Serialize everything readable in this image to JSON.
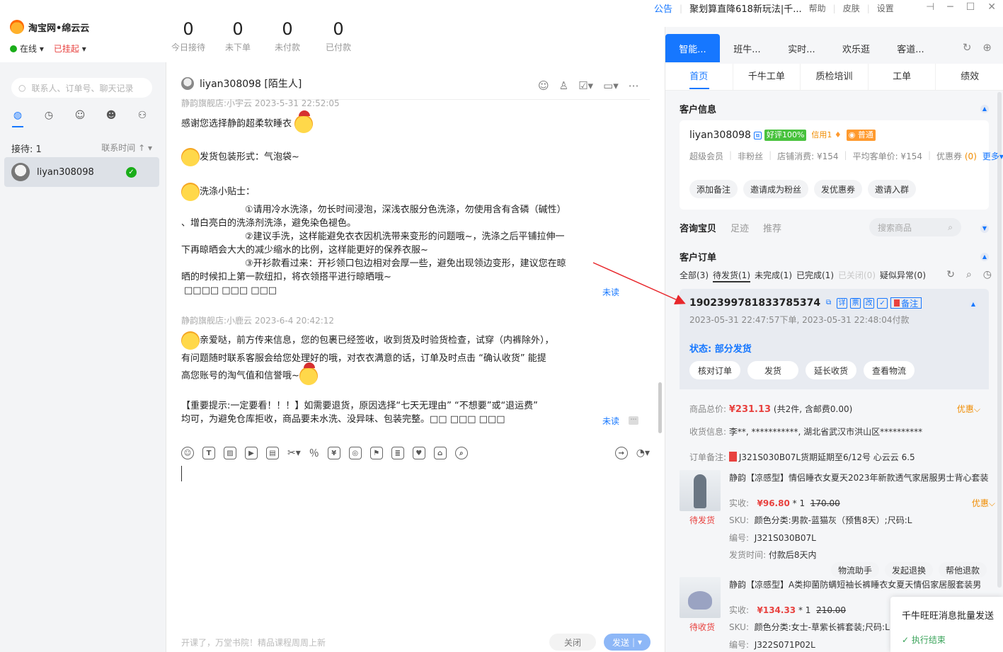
{
  "app": {
    "brand": "淘宝网•绵云云",
    "status_online": "在线",
    "status_hang": "已挂起",
    "stats": [
      {
        "value": "0",
        "label": "今日接待"
      },
      {
        "value": "0",
        "label": "未下单"
      },
      {
        "value": "0",
        "label": "未付款"
      },
      {
        "value": "0",
        "label": "已付款"
      }
    ],
    "notice_label": "公告",
    "notice_text": "聚划算直降618新玩法|千...",
    "menu": [
      "帮助",
      "皮肤",
      "设置"
    ]
  },
  "left": {
    "search_placeholder": "联系人、订单号、聊天记录",
    "recv_label": "接待: 1",
    "sort_label": "联系时间 ↑ ▾",
    "contact_name": "liyan308098"
  },
  "chat": {
    "header_name": "liyan308098 [陌生人]",
    "msg1_meta": "静韵旗舰店:小宇云   2023-5-31 22:52:05",
    "msg1_line1": "感谢您选择静韵超柔软睡衣",
    "msg1_line2": "发货包装形式：气泡袋~",
    "msg1_line3": "洗涤小贴士：",
    "msg1_tip1a": "①请用冷水洗涤，勿长时间浸泡，深浅衣服分色洗涤，勿使用含有含磷（碱性）",
    "msg1_tip1b": "、增白亮白的洗涤剂洗涤，避免染色褪色。",
    "msg1_tip2a": "②建议手洗，这样能避免衣衣因机洗带来变形的问题哦~，洗涤之后平铺拉伸一",
    "msg1_tip2b": "下再晾晒会大大的减少缩水的比例，这样能更好的保养衣服~",
    "msg1_tip3a": "③开衫款看过来：开衫领口包边相对会厚一些，避免出现领边变形，建议您在晾",
    "msg1_tip3b": "晒的时候扣上第一款纽扣，将衣领搭平进行晾晒哦~",
    "msg1_tail": "□□□□ □□□ □□□",
    "msg2_meta": "静韵旗舰店:小鹿云   2023-6-4 20:42:12",
    "msg2_line1": "亲爱哒，前方传来信息，您的包裹已经签收，收到货及时验货检查，试穿（内裤除外），",
    "msg2_line2": "有问题随时联系客服会给您处理好的哦，对衣衣满意的话，订单及时点击  “确认收货”   能提",
    "msg2_line3": "高您账号的淘气值和信誉哦~",
    "msg2_line4": "【重要提示:一定要看！！！】如需要退货，原因选择“七天无理由”  “不想要”或“退运费”",
    "msg2_line5": "均可，为避免仓库拒收，商品要未水洗、没异味、包装完整。□□              □□□ □□□",
    "unread": "未读",
    "footer_tip": "开课了，万堂书院！精品课程周周上新",
    "close_label": "关闭",
    "send_label": "发送"
  },
  "right": {
    "tabs": [
      "智能...",
      "班牛...",
      "实时...",
      "欢乐逛",
      "客道..."
    ],
    "subtabs": [
      "首页",
      "千牛工单",
      "质检培训",
      "工单",
      "绩效"
    ],
    "cust_title": "客户信息",
    "cust_name": "liyan308098",
    "badge_good": "好评100%",
    "badge_credit": "信用1",
    "badge_level": "普通",
    "meta_vip": "超级会员",
    "meta_fans": "非粉丝",
    "meta_spend": "店铺消费: ¥154",
    "meta_avg": "平均客单价: ¥154",
    "meta_coupon": "优惠券",
    "meta_coupon_n": "(0)",
    "meta_more": "更多▾",
    "cust_actions": [
      "添加备注",
      "邀请成为粉丝",
      "发优惠券",
      "邀请入群"
    ],
    "consult_tabs": [
      "咨询宝贝",
      "足迹",
      "推荐"
    ],
    "goods_search": "搜索商品",
    "order_title": "客户订单",
    "filters": [
      "全部(3)",
      "待发货(1)",
      "未完成(1)",
      "已完成(1)",
      "已关闭(0)",
      "疑似异常(0)"
    ],
    "order_id": "1902399781833785374",
    "order_icons": [
      "详",
      "票",
      "改",
      "✓"
    ],
    "remark_tag": "备注",
    "order_time": "2023-05-31 22:47:57下单,   2023-05-31 22:48:04付款",
    "order_status": "状态: 部分发货",
    "order_btns": [
      "核对订单",
      "发货",
      "延长收货",
      "查看物流"
    ],
    "total_label": "商品总价:",
    "total_price": "¥231.13",
    "total_note": "(共2件, 含邮费0.00)",
    "youhui": "优惠⌵",
    "addr_label": "收货信息:",
    "addr_val": "李**, ***********, 湖北省武汉市洪山区**********",
    "remark_label": "订单备注:",
    "remark_val": "J321S030B07L货期延期至6/12号 心云云 6.5",
    "p1_title": "静韵【凉感型】情侣睡衣女夏天2023年新款透气家居服男士背心套装",
    "p1_status": "待发货",
    "p1_paid_label": "实收:",
    "p1_price": "¥96.80",
    "p1_qty": "* 1",
    "p1_orig": "170.00",
    "p1_sku_label": "SKU:",
    "p1_sku": "颜色分类:男款-蓝猫灰（预售8天）;尺码:L",
    "p1_code_label": "编号:",
    "p1_code": "J321S030B07L",
    "p1_ship_label": "发货时间:",
    "p1_ship": "付款后8天内",
    "p1_actions": [
      "物流助手",
      "发起退换",
      "帮他退款"
    ],
    "p2_title": "静韵【凉感型】A类抑菌防螨短袖长裤睡衣女夏天情侣家居服套装男",
    "p2_status": "待收货",
    "p2_price": "¥134.33",
    "p2_qty": "* 1",
    "p2_orig": "210.00",
    "p2_sku": "颜色分类:女士-草紫长裤套装;尺码:L",
    "p2_code": "J322S071P02L"
  },
  "toast": {
    "title": "千牛旺旺消息批量发送",
    "status": "执行结束"
  },
  "colors": {
    "accent": "#1677ff",
    "danger": "#e8423f",
    "warn": "#f08c00",
    "ok": "#1aad19"
  }
}
